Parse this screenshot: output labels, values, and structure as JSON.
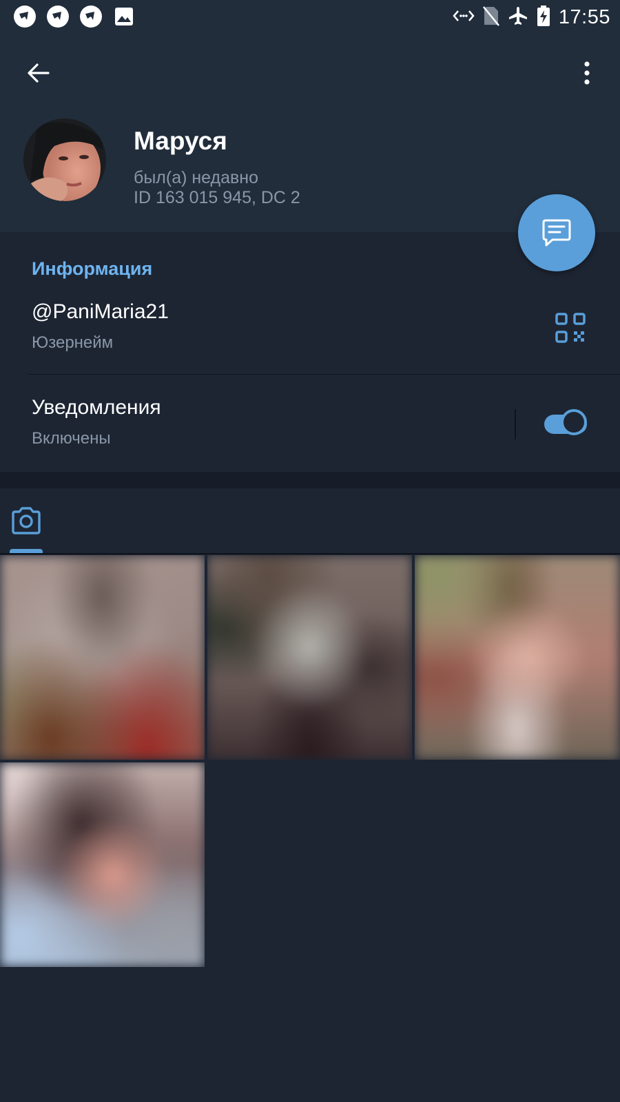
{
  "status_bar": {
    "time": "17:55",
    "left_icons": [
      "notification-app-icon",
      "notification-app-icon",
      "notification-app-icon",
      "image-icon"
    ],
    "right_icons": [
      "data-transfer-icon",
      "no-sim-icon",
      "airplane-icon",
      "battery-charging-icon"
    ]
  },
  "header": {
    "back_icon": "arrow-left-icon",
    "menu_icon": "more-vertical-icon",
    "name": "Маруся",
    "last_seen": "был(а) недавно",
    "id_line": "ID 163 015 945, DC 2"
  },
  "fab": {
    "icon": "message-icon"
  },
  "info": {
    "title": "Информация",
    "username": "@PaniMaria21",
    "username_label": "Юзернейм",
    "notifications": "Уведомления",
    "notifications_state": "Включены",
    "notifications_enabled": true
  },
  "media_tabs": [
    {
      "icon": "camera-icon",
      "selected": true
    }
  ],
  "colors": {
    "accent": "#5a9fd9",
    "header_bg": "#212d3b",
    "body_bg": "#1d2533",
    "section_title": "#6fb4ef"
  }
}
